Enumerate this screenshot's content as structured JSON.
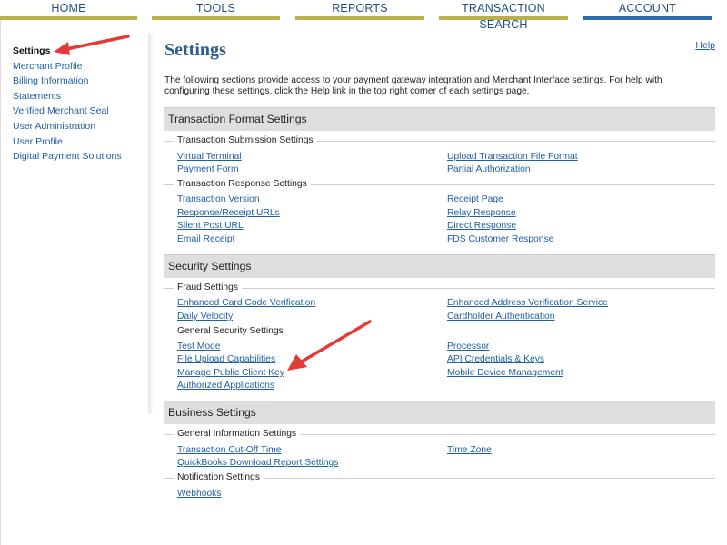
{
  "nav": {
    "tabs": [
      "HOME",
      "TOOLS",
      "REPORTS",
      "TRANSACTION SEARCH",
      "ACCOUNT"
    ],
    "active": "ACCOUNT"
  },
  "sidebar": {
    "items": [
      "Settings",
      "Merchant Profile",
      "Billing Information",
      "Statements",
      "Verified Merchant Seal",
      "User Administration",
      "User Profile",
      "Digital Payment Solutions"
    ]
  },
  "main": {
    "title": "Settings",
    "help": "Help",
    "intro": "The following sections provide access to your payment gateway integration and Merchant Interface settings. For help with configuring these settings, click the Help link in the top right corner of each settings page."
  },
  "sections": {
    "transaction_format": {
      "title": "Transaction Format Settings",
      "submission": {
        "label": "Transaction Submission Settings",
        "left": [
          "Virtual Terminal",
          "Payment Form"
        ],
        "right": [
          "Upload Transaction File Format",
          "Partial Authorization"
        ]
      },
      "response": {
        "label": "Transaction Response Settings",
        "left": [
          "Transaction Version",
          "Response/Receipt URLs",
          "Silent Post URL",
          "Email Receipt"
        ],
        "right": [
          "Receipt Page",
          "Relay Response",
          "Direct Response",
          "FDS Customer Response"
        ]
      }
    },
    "security": {
      "title": "Security Settings",
      "fraud": {
        "label": "Fraud Settings",
        "left": [
          "Enhanced Card Code Verification",
          "Daily Velocity"
        ],
        "right": [
          "Enhanced Address Verification Service",
          "Cardholder Authentication"
        ]
      },
      "general": {
        "label": "General Security Settings",
        "left": [
          "Test Mode",
          "File Upload Capabilities",
          "Manage Public Client Key",
          "Authorized Applications"
        ],
        "right": [
          "Processor",
          "API Credentials & Keys",
          "Mobile Device Management"
        ]
      }
    },
    "business": {
      "title": "Business Settings",
      "general_info": {
        "label": "General Information Settings",
        "left": [
          "Transaction Cut-Off Time",
          "QuickBooks Download Report Settings"
        ],
        "right": [
          "Time Zone"
        ]
      },
      "notification": {
        "label": "Notification Settings",
        "left": [
          "Webhooks"
        ]
      }
    }
  },
  "colors": {
    "link": "#1f5fa5",
    "tab_bar": "#b8b04a",
    "active_tab_bar": "#2d6cb0",
    "section_bg": "#dedede",
    "annotation_arrow": "#e53935"
  }
}
